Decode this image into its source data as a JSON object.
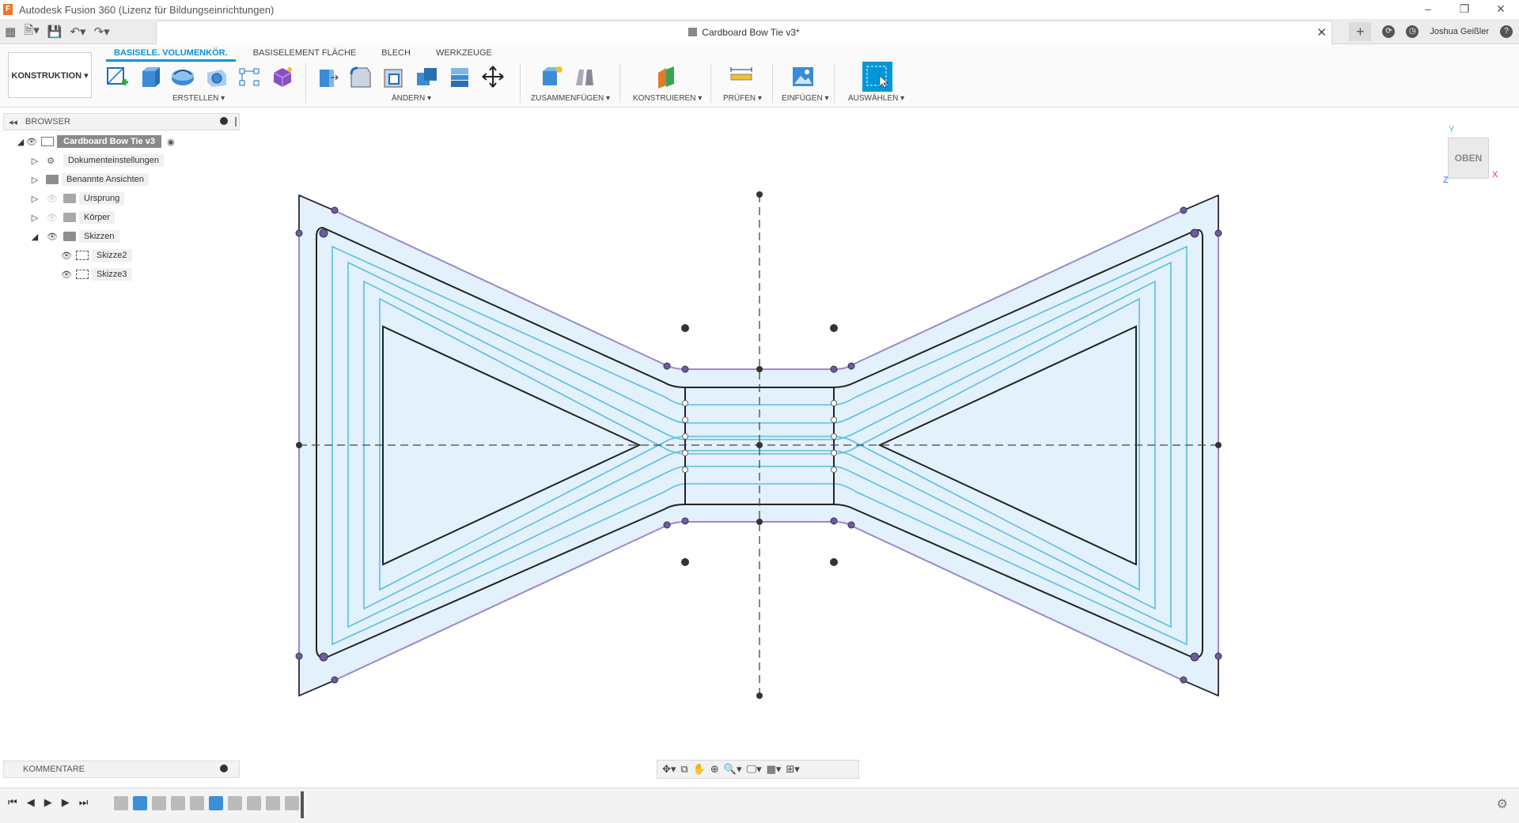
{
  "window": {
    "title": "Autodesk Fusion 360 (Lizenz für Bildungseinrichtungen)",
    "app_icon": "F",
    "controls": [
      "–",
      "❐",
      "✕"
    ]
  },
  "document": {
    "title": "Cardboard Bow Tie v3*",
    "close": "✕"
  },
  "user": {
    "name": "Joshua Geißler"
  },
  "workspace": {
    "label": "KONSTRUKTION ▾"
  },
  "ribbon": {
    "tabs": [
      "BASISELE. VOLUMENKÖR.",
      "BASISELEMENT FLÄCHE",
      "BLECH",
      "WERKZEUGE"
    ],
    "groups": [
      "ERSTELLEN ▾",
      "ÄNDERN ▾",
      "ZUSAMMENFÜGEN ▾",
      "KONSTRUIEREN ▾",
      "PRÜFEN ▾",
      "EINFÜGEN ▾",
      "AUSWÄHLEN ▾"
    ]
  },
  "browser": {
    "title": "BROWSER",
    "root": "Cardboard Bow Tie v3",
    "items": [
      "Dokumenteinstellungen",
      "Benannte Ansichten",
      "Ursprung",
      "Körper",
      "Skizzen",
      "Skizze2",
      "Skizze3"
    ]
  },
  "comments": {
    "label": "KOMMENTARE"
  },
  "viewcube": {
    "label": "OBEN",
    "x": "X",
    "y": "Y",
    "z": "Z"
  },
  "colors": {
    "accent": "#0696d7",
    "sketch_fill": "#dff0fa",
    "profile_line": "#9a8ac8",
    "offset_line": "#5cbde0"
  }
}
